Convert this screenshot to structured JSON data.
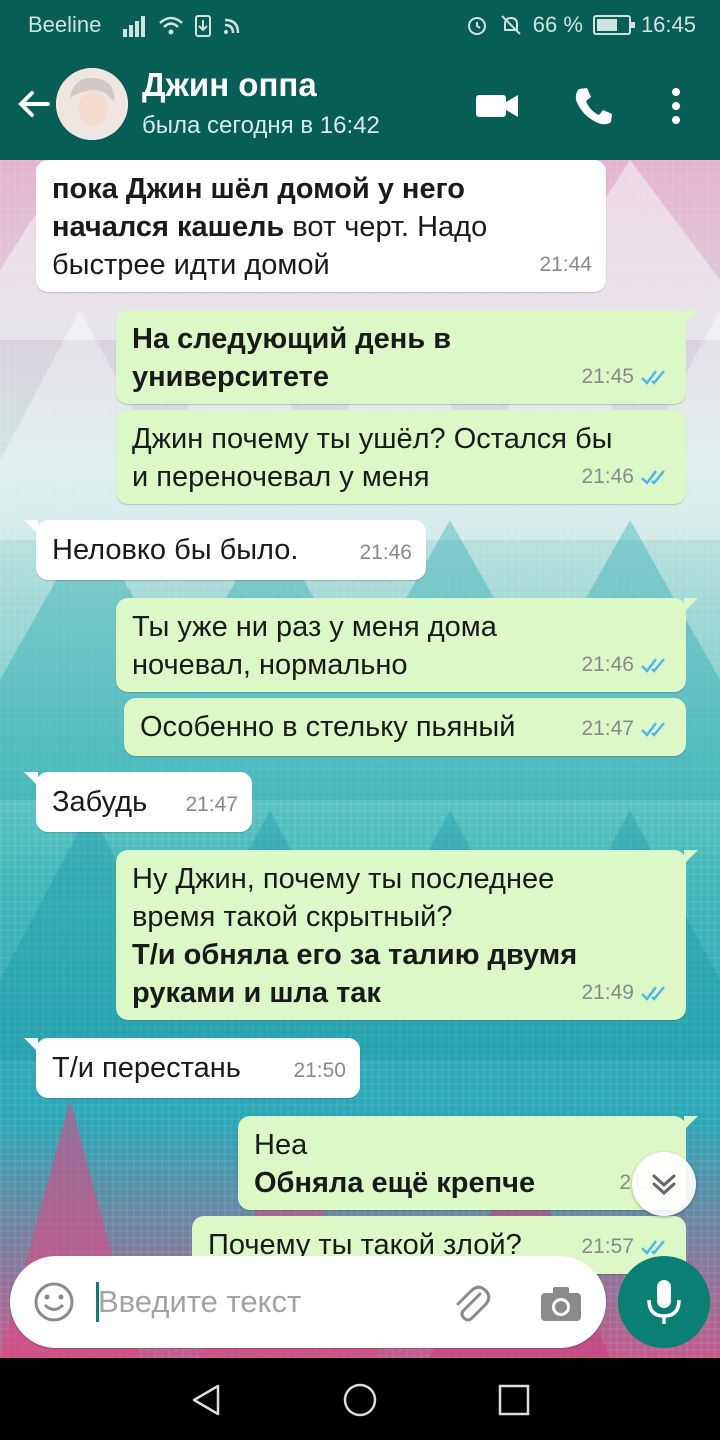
{
  "status_bar": {
    "carrier": "Beeline",
    "battery": "66 %",
    "battery_level": 0.66,
    "time": "16:45"
  },
  "header": {
    "contact_name": "Джин оппа",
    "last_seen": "была сегодня в 16:42"
  },
  "messages": [
    {
      "dir": "in",
      "time": "21:44",
      "parts": [
        {
          "text": "пока Джин шёл домой у него",
          "bold": true
        },
        {
          "text": "начался кашель",
          "bold": true
        },
        {
          "text": " вот черт. Надо",
          "bold": false
        },
        {
          "text": "быстрее идти домой",
          "bold": false
        }
      ]
    },
    {
      "dir": "out",
      "time": "21:45",
      "parts": [
        {
          "text": "На следующий день в",
          "bold": true
        },
        {
          "text": "университете",
          "bold": true
        }
      ]
    },
    {
      "dir": "out",
      "time": "21:46",
      "parts": [
        {
          "text": "Джин почему ты ушёл? Остался бы",
          "bold": false
        },
        {
          "text": "и переночевал у меня",
          "bold": false
        }
      ]
    },
    {
      "dir": "in",
      "time": "21:46",
      "parts": [
        {
          "text": "Неловко бы было.",
          "bold": false
        }
      ]
    },
    {
      "dir": "out",
      "time": "21:46",
      "parts": [
        {
          "text": "Ты уже ни раз у меня дома",
          "bold": false
        },
        {
          "text": "ночевал, нормально",
          "bold": false
        }
      ]
    },
    {
      "dir": "out",
      "time": "21:47",
      "parts": [
        {
          "text": "Особенно в стельку пьяный",
          "bold": false
        }
      ]
    },
    {
      "dir": "in",
      "time": "21:47",
      "parts": [
        {
          "text": "Забудь",
          "bold": false
        }
      ]
    },
    {
      "dir": "out",
      "time": "21:49",
      "parts": [
        {
          "text": "Ну Джин, почему ты последнее",
          "bold": false
        },
        {
          "text": "время такой скрытный?",
          "bold": false
        },
        {
          "text": "Т/и обняла его за талию двумя",
          "bold": true
        },
        {
          "text": "руками и шла так",
          "bold": true
        }
      ]
    },
    {
      "dir": "in",
      "time": "21:50",
      "parts": [
        {
          "text": "Т/и перестань",
          "bold": false
        }
      ]
    },
    {
      "dir": "out",
      "time": "21:56",
      "parts": [
        {
          "text": "Неа",
          "bold": false
        },
        {
          "text": " Обняла ещё крепче",
          "bold": true
        }
      ]
    },
    {
      "dir": "out",
      "time": "21:57",
      "parts": [
        {
          "text": "Почему ты такой злой?",
          "bold": false
        }
      ]
    }
  ],
  "input": {
    "placeholder": "Введите текст"
  },
  "icons": {
    "back": "arrow-left-icon",
    "video": "video-call-icon",
    "call": "phone-icon",
    "menu": "more-vert-icon",
    "emoji": "emoji-icon",
    "attach": "paperclip-icon",
    "camera": "camera-icon",
    "mic": "mic-icon",
    "scroll": "chevron-double-down-icon"
  },
  "colors": {
    "header": "#075e54",
    "accent": "#0a7f73",
    "bubble_out": "#dcf8c6",
    "bubble_in": "#ffffff",
    "read_ticks": "#4fb6ec"
  }
}
